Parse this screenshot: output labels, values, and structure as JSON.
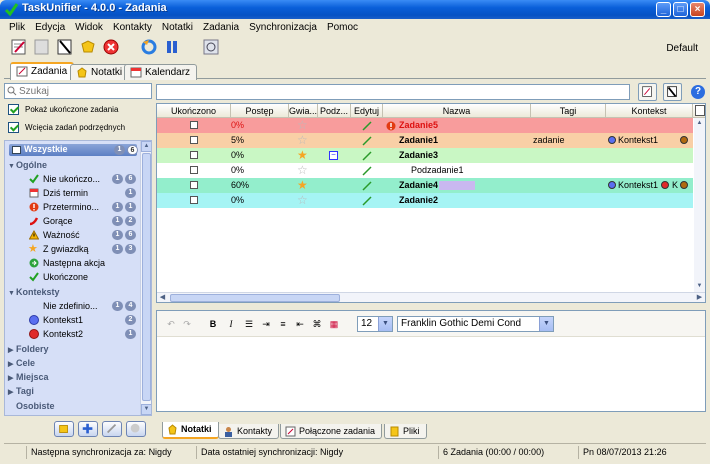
{
  "window": {
    "title": "TaskUnifier - 4.0.0 - Zadania"
  },
  "menu": [
    "Plik",
    "Edycja",
    "Widok",
    "Kontakty",
    "Notatki",
    "Zadania",
    "Synchronizacja",
    "Pomoc"
  ],
  "toolbar": {
    "profile": "Default"
  },
  "tabs": [
    {
      "label": "Zadania",
      "active": true
    },
    {
      "label": "Notatki",
      "active": false
    },
    {
      "label": "Kalendarz",
      "active": false
    }
  ],
  "left": {
    "search_placeholder": "Szukaj",
    "show_completed": "Pokaż ukończone zadania",
    "indent_subtasks": "Wcięcia zadań podrzędnych",
    "all_label": "Wszystkie",
    "all_badge1": "1",
    "all_badge2": "6",
    "groups": {
      "general": "Ogólne",
      "contexts": "Konteksty",
      "folders": "Foldery",
      "goals": "Cele",
      "places": "Miejsca",
      "tags": "Tagi",
      "people": "Osobiste"
    },
    "general_items": [
      {
        "label": "Nie ukończo...",
        "b1": "1",
        "b2": "6"
      },
      {
        "label": "Dziś termin",
        "b1": "",
        "b2": "1"
      },
      {
        "label": "Przetermino...",
        "b1": "1",
        "b2": "1"
      },
      {
        "label": "Gorące",
        "b1": "1",
        "b2": "2"
      },
      {
        "label": "Ważność",
        "b1": "1",
        "b2": "6"
      },
      {
        "label": "Z gwiazdką",
        "b1": "1",
        "b2": "3"
      },
      {
        "label": "Następna akcja",
        "b1": "",
        "b2": ""
      },
      {
        "label": "Ukończone",
        "b1": "",
        "b2": ""
      }
    ],
    "context_items": [
      {
        "label": "Nie zdefinio...",
        "b1": "1",
        "b2": "4"
      },
      {
        "label": "Kontekst1",
        "b1": "",
        "b2": "2"
      },
      {
        "label": "Kontekst2",
        "b1": "",
        "b2": "1"
      }
    ]
  },
  "grid": {
    "columns": [
      "Ukończono",
      "Postęp",
      "Gwia...",
      "Podz...",
      "Edytuj",
      "Nazwa",
      "Tagi",
      "Kontekst"
    ],
    "rows": [
      {
        "progress": "0%",
        "name": "Zadanie5",
        "tags": "",
        "context": "",
        "bg": "#f89c9c",
        "star": false,
        "overdue": true,
        "bold": true,
        "redtext": true
      },
      {
        "progress": "5%",
        "name": "Zadanie1",
        "tags": "zadanie",
        "context": "Kontekst1",
        "bg": "#f9cfa6",
        "star": false,
        "bold": true
      },
      {
        "progress": "0%",
        "name": "Zadanie3",
        "tags": "",
        "context": "",
        "bg": "#c9f7c4",
        "star": true,
        "bold": true,
        "subtasks": true
      },
      {
        "progress": "0%",
        "name": "Podzadanie1",
        "tags": "",
        "context": "",
        "bg": "#ffffff",
        "star": false,
        "bold": false,
        "indent": true
      },
      {
        "progress": "60%",
        "name": "Zadanie4",
        "tags": "",
        "context": "Kontekst1",
        "context2": "K",
        "bg": "#93eecc",
        "star": true,
        "bold": true
      },
      {
        "progress": "0%",
        "name": "Zadanie2",
        "tags": "",
        "context": "",
        "bg": "#a5f4f4",
        "star": false,
        "bold": true
      }
    ]
  },
  "editor": {
    "font_size": "12",
    "font_name": "Franklin Gothic Demi Cond"
  },
  "subtabs": [
    {
      "label": "Notatki",
      "active": true
    },
    {
      "label": "Kontakty",
      "active": false
    },
    {
      "label": "Połączone zadania",
      "active": false
    },
    {
      "label": "Pliki",
      "active": false
    }
  ],
  "status": {
    "next_sync": "Następna synchronizacja za: Nigdy",
    "last_sync": "Data ostatniej synchronizacji: Nigdy",
    "tasks": "6 Zadania (00:00 / 00:00)",
    "date": "Pn 08/07/2013 21:26"
  },
  "colors": {
    "accent": "#0552c4",
    "context1": "#5a6ef0",
    "context2": "#e02a2a",
    "star": "#f5a623"
  }
}
